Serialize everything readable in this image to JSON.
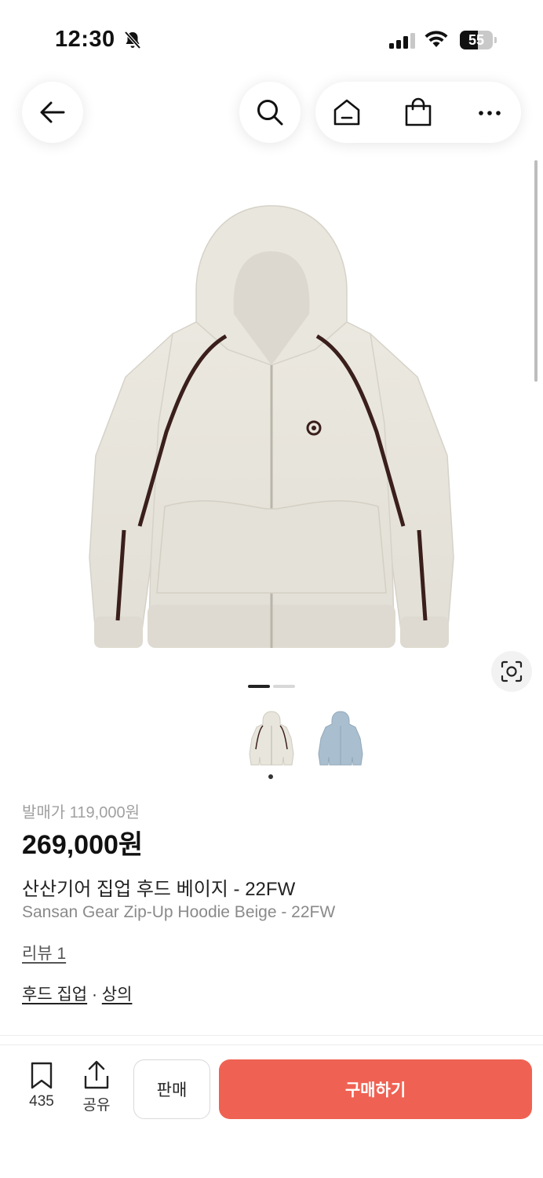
{
  "status_bar": {
    "time": "12:30",
    "battery_level": "55",
    "battery_fraction": 0.55
  },
  "icons": {
    "back": "back-arrow-icon",
    "search": "search-icon",
    "home": "home-icon",
    "cart": "shopping-bag-icon",
    "more": "more-dots-icon",
    "camera": "image-search-icon",
    "bookmark": "bookmark-icon",
    "share": "share-icon"
  },
  "gallery": {
    "page_count": 2,
    "current_page": 1,
    "thumbnails": [
      {
        "color_name": "beige",
        "color": "#e8e5dd"
      },
      {
        "color_name": "blue",
        "color": "#a9bfd0"
      }
    ],
    "selected_thumbnail": 1
  },
  "product": {
    "release_price": "발매가 119,000원",
    "price": "269,000원",
    "name_ko": "산산기어 집업 후드 베이지 - 22FW",
    "name_en": "Sansan Gear Zip-Up Hoodie Beige - 22FW",
    "review": "리뷰 1",
    "category_1": "후드 집업",
    "category_sep": " · ",
    "category_2": "상의"
  },
  "bottom_bar": {
    "bookmark_count": "435",
    "share_label": "공유",
    "sell_label": "판매",
    "buy_label": "구매하기"
  },
  "colors": {
    "accent": "#ef6253",
    "hoodie_body": "#e7e4db",
    "hoodie_stripe": "#3a1f1c"
  }
}
